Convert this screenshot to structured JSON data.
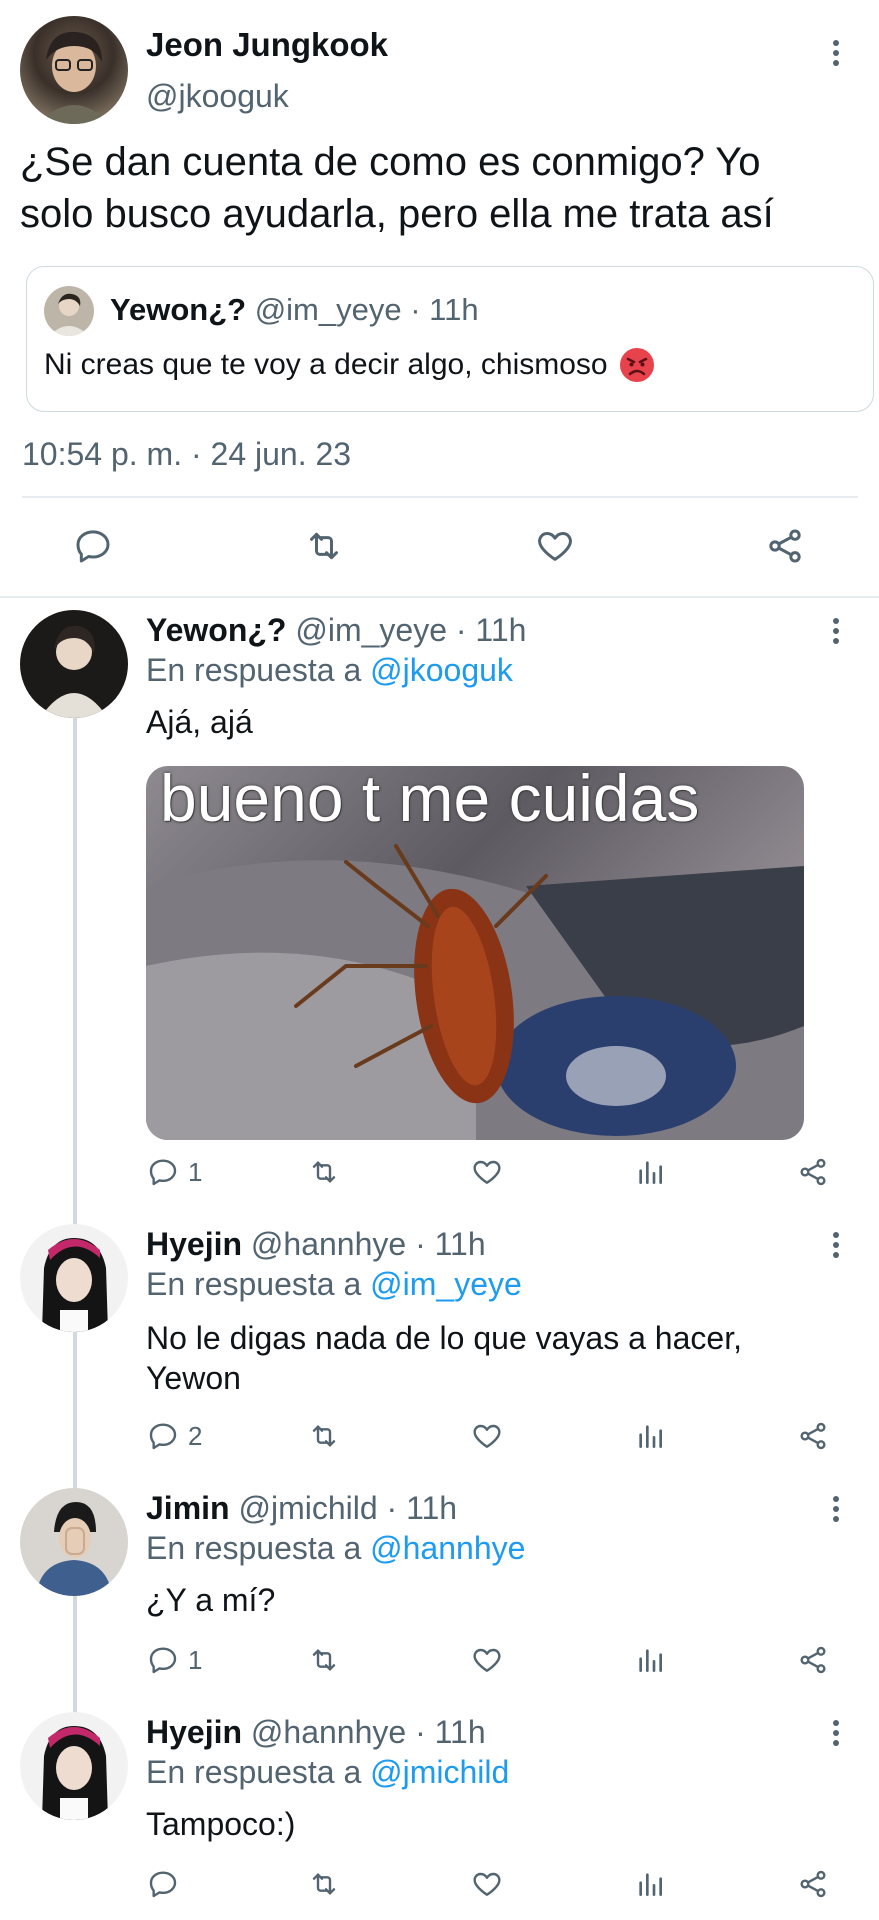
{
  "main_tweet": {
    "author_name": "Jeon Jungkook",
    "author_handle": "@jkooguk",
    "text_line1": "¿Se dan cuenta de como es conmigo? Yo",
    "text_line2": "solo busco ayudarla, pero ella me trata así",
    "quoted": {
      "author_name": "Yewon¿?",
      "meta": "@im_yeye · 11h",
      "text": "Ni creas que te voy a decir algo, chismoso"
    },
    "timestamp": "10:54 p. m. · 24 jun. 23"
  },
  "replies": [
    {
      "author_name": "Yewon¿?",
      "meta": "@im_yeye · 11h",
      "reply_prefix": "En respuesta a",
      "reply_to": "@jkooguk",
      "text": "Ajá, ajá",
      "image_caption": "bueno t me cuidas",
      "reply_count": "1"
    },
    {
      "author_name": "Hyejin",
      "meta": "@hannhye · 11h",
      "reply_prefix": "En respuesta a",
      "reply_to": "@im_yeye",
      "text": "No le digas nada de lo que vayas a hacer, Yewon",
      "reply_count": "2"
    },
    {
      "author_name": "Jimin",
      "meta": "@jmichild · 11h",
      "reply_prefix": "En respuesta a",
      "reply_to": "@hannhye",
      "text": "¿Y a mí?",
      "reply_count": "1"
    },
    {
      "author_name": "Hyejin",
      "meta": "@hannhye · 11h",
      "reply_prefix": "En respuesta a",
      "reply_to": "@jmichild",
      "text": "Tampoco:)",
      "reply_count": ""
    }
  ],
  "icons": [
    "reply-icon",
    "retweet-icon",
    "like-icon",
    "views-icon",
    "share-icon",
    "more-icon",
    "angry-emoji-icon"
  ],
  "colors": {
    "accent": "#1d9bf0",
    "text": "#0f1419",
    "muted": "#536471",
    "border": "#cfd9de"
  }
}
